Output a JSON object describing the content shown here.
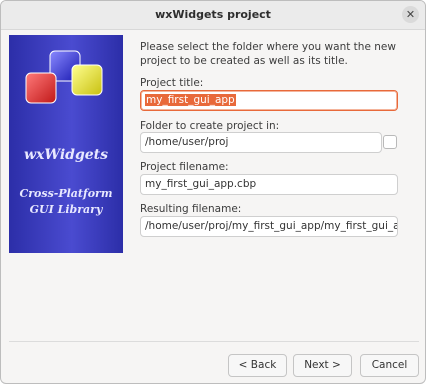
{
  "window": {
    "title": "wxWidgets project",
    "close_icon": "✕"
  },
  "banner": {
    "title": "wxWidgets",
    "subtitle_line1": "Cross-Platform",
    "subtitle_line2": "GUI Library",
    "logo_colors": [
      "#e03030",
      "#3030e0",
      "#e8e030"
    ]
  },
  "form": {
    "intro": "Please select the folder where you want the new project to be created as well as its title.",
    "project_title_label": "Project title:",
    "project_title_value": "my_first_gui_app",
    "folder_label": "Folder to create project in:",
    "folder_value": "/home/user/proj",
    "filename_label": "Project filename:",
    "filename_value": "my_first_gui_app.cbp",
    "resulting_label": "Resulting filename:",
    "resulting_value": "/home/user/proj/my_first_gui_app/my_first_gui_app.cbp"
  },
  "buttons": {
    "back": "< Back",
    "next": "Next >",
    "cancel": "Cancel"
  },
  "colors": {
    "banner": "#3a3cc0",
    "accent": "#e8693a"
  }
}
